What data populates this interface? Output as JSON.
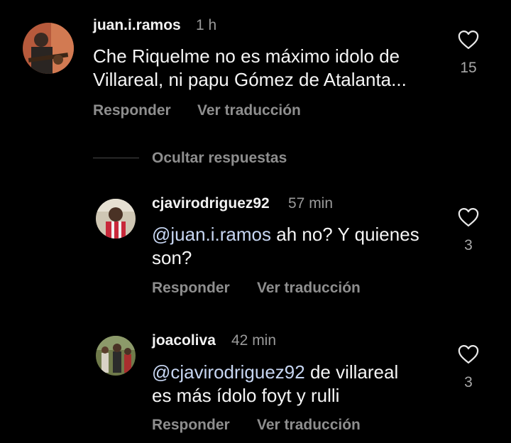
{
  "comments": [
    {
      "username": "juan.i.ramos",
      "time": "1 h",
      "text": "Che Riquelme no es máximo idolo de\nVillareal, ni papu Gómez de Atalanta...",
      "mention": "",
      "reply_label": "Responder",
      "translate_label": "Ver traducción",
      "likes": "15"
    },
    {
      "username": "cjavirodriguez92",
      "time": "57 min",
      "mention": "@juan.i.ramos",
      "text": " ah no? Y quienes\nson?",
      "reply_label": "Responder",
      "translate_label": "Ver traducción",
      "likes": "3"
    },
    {
      "username": "joacoliva",
      "time": "42 min",
      "mention": "@cjavirodriguez92",
      "text": " de villareal\nes más ídolo foyt y rulli",
      "reply_label": "Responder",
      "translate_label": "Ver traducción",
      "likes": "3"
    }
  ],
  "hide_replies_label": "Ocultar respuestas"
}
